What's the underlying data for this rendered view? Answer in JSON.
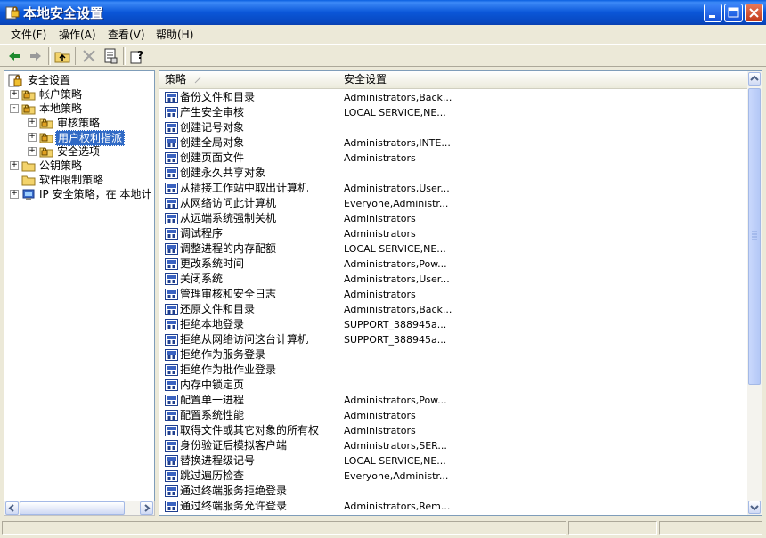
{
  "window": {
    "title": "本地安全设置"
  },
  "menu": {
    "items": [
      "文件(F)",
      "操作(A)",
      "查看(V)",
      "帮助(H)"
    ]
  },
  "toolbar": {
    "icons": [
      "back-icon",
      "forward-icon",
      "up-folder-icon",
      "delete-icon",
      "properties-icon",
      "help-icon"
    ]
  },
  "tree": {
    "root": "安全设置",
    "items": [
      {
        "label": "帐户策略",
        "indent": 1,
        "expander": "+"
      },
      {
        "label": "本地策略",
        "indent": 1,
        "expander": "-"
      },
      {
        "label": "审核策略",
        "indent": 2,
        "expander": "+"
      },
      {
        "label": "用户权利指派",
        "indent": 2,
        "expander": "+",
        "selected": true
      },
      {
        "label": "安全选项",
        "indent": 2,
        "expander": "+"
      },
      {
        "label": "公钥策略",
        "indent": 1,
        "expander": "+"
      },
      {
        "label": "软件限制策略",
        "indent": 1,
        "expander": ""
      },
      {
        "label": "IP 安全策略，在 本地计",
        "indent": 1,
        "expander": "+"
      }
    ]
  },
  "list": {
    "columns": [
      "策略",
      "安全设置"
    ],
    "rows": [
      {
        "name": "备份文件和目录",
        "setting": "Administrators,Back..."
      },
      {
        "name": "产生安全审核",
        "setting": "LOCAL SERVICE,NE..."
      },
      {
        "name": "创建记号对象",
        "setting": ""
      },
      {
        "name": "创建全局对象",
        "setting": "Administrators,INTE..."
      },
      {
        "name": "创建页面文件",
        "setting": "Administrators"
      },
      {
        "name": "创建永久共享对象",
        "setting": ""
      },
      {
        "name": "从插接工作站中取出计算机",
        "setting": "Administrators,User..."
      },
      {
        "name": "从网络访问此计算机",
        "setting": "Everyone,Administr..."
      },
      {
        "name": "从远端系统强制关机",
        "setting": "Administrators"
      },
      {
        "name": "调试程序",
        "setting": "Administrators"
      },
      {
        "name": "调整进程的内存配额",
        "setting": "LOCAL SERVICE,NE..."
      },
      {
        "name": "更改系统时间",
        "setting": "Administrators,Pow..."
      },
      {
        "name": "关闭系统",
        "setting": "Administrators,User..."
      },
      {
        "name": "管理审核和安全日志",
        "setting": "Administrators"
      },
      {
        "name": "还原文件和目录",
        "setting": "Administrators,Back..."
      },
      {
        "name": "拒绝本地登录",
        "setting": "SUPPORT_388945a..."
      },
      {
        "name": "拒绝从网络访问这台计算机",
        "setting": "SUPPORT_388945a..."
      },
      {
        "name": "拒绝作为服务登录",
        "setting": ""
      },
      {
        "name": "拒绝作为批作业登录",
        "setting": ""
      },
      {
        "name": "内存中锁定页",
        "setting": ""
      },
      {
        "name": "配置单一进程",
        "setting": "Administrators,Pow..."
      },
      {
        "name": "配置系统性能",
        "setting": "Administrators"
      },
      {
        "name": "取得文件或其它对象的所有权",
        "setting": "Administrators"
      },
      {
        "name": "身份验证后模拟客户端",
        "setting": "Administrators,SER..."
      },
      {
        "name": "替换进程级记号",
        "setting": "LOCAL SERVICE,NE..."
      },
      {
        "name": "跳过遍历检查",
        "setting": "Everyone,Administr..."
      },
      {
        "name": "通过终端服务拒绝登录",
        "setting": ""
      },
      {
        "name": "通过终端服务允许登录",
        "setting": "Administrators,Rem..."
      }
    ]
  }
}
